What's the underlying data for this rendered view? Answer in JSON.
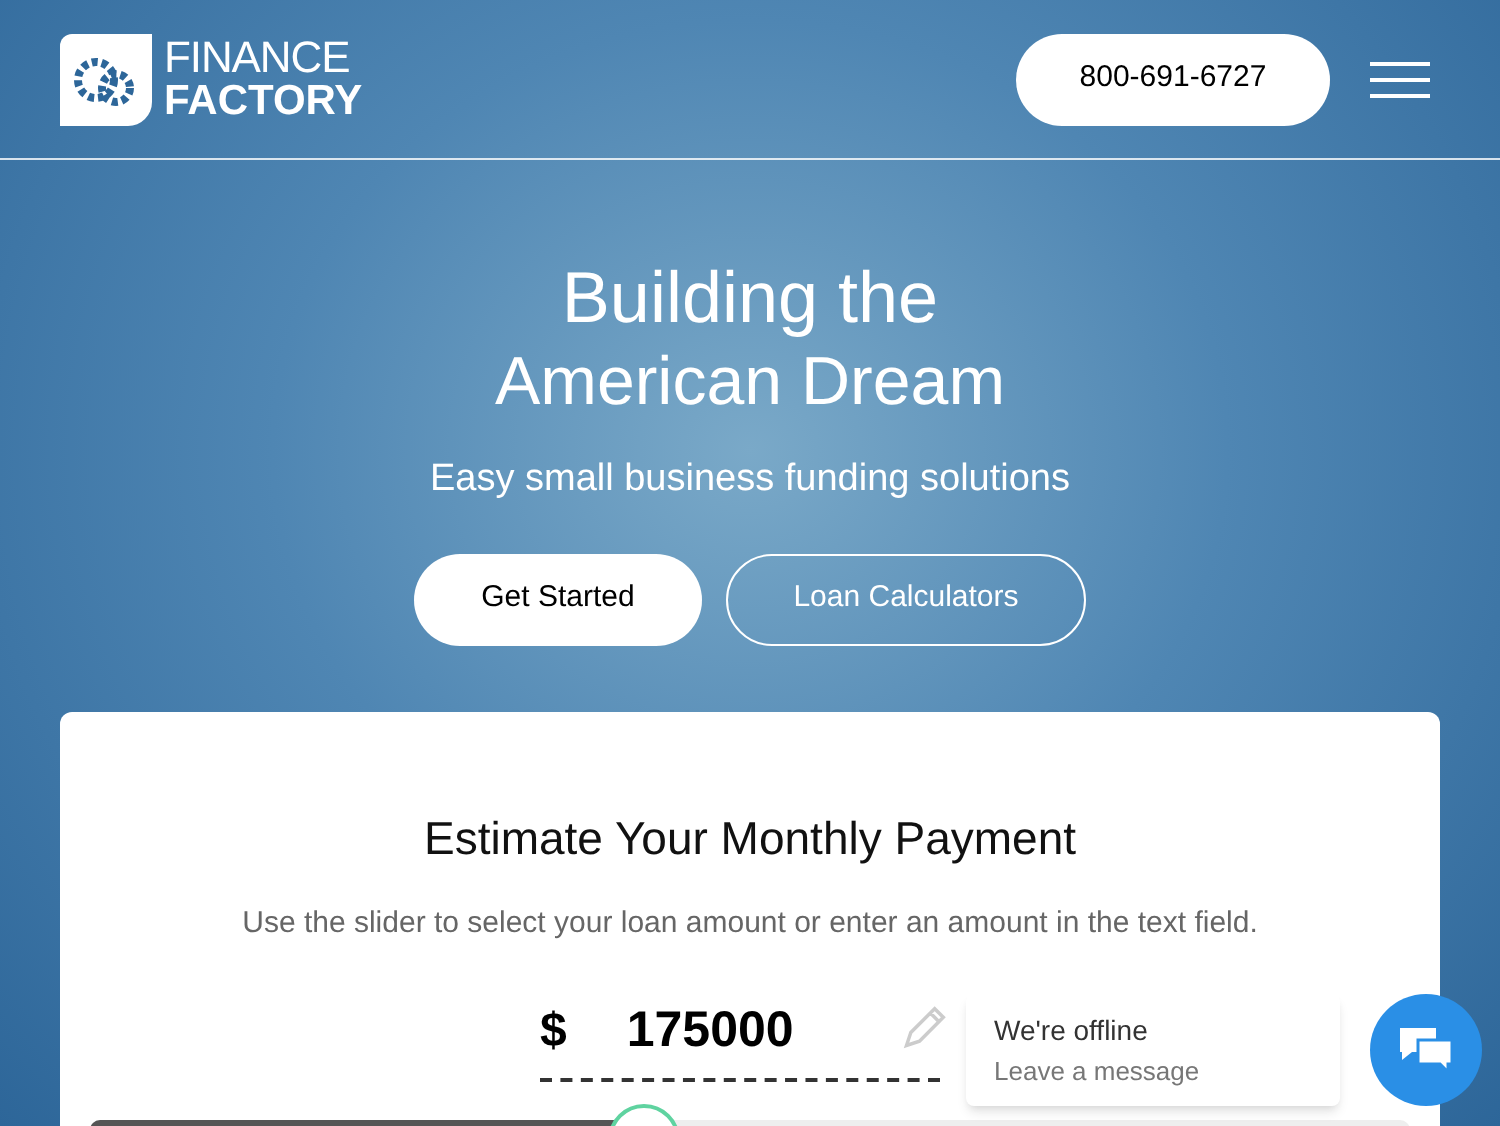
{
  "header": {
    "logo_top": "FINANCE",
    "logo_bottom": "FACTORY",
    "phone": "800-691-6727"
  },
  "hero": {
    "title_line_1": "Building the",
    "title_line_2": "American Dream",
    "subtitle": "Easy small business funding solutions",
    "buttons": [
      {
        "label": "Get Started",
        "kind": "primary"
      },
      {
        "label": "Loan Calculators",
        "kind": "outline"
      }
    ]
  },
  "calculator": {
    "title": "Estimate Your Monthly Payment",
    "instructions": "Use the slider to select your loan amount or enter an amount in the text field.",
    "currency": "$",
    "amount": "175000",
    "slider": {
      "level": 0.42
    }
  },
  "chat": {
    "status": "We're offline",
    "prompt": "Leave a message"
  }
}
